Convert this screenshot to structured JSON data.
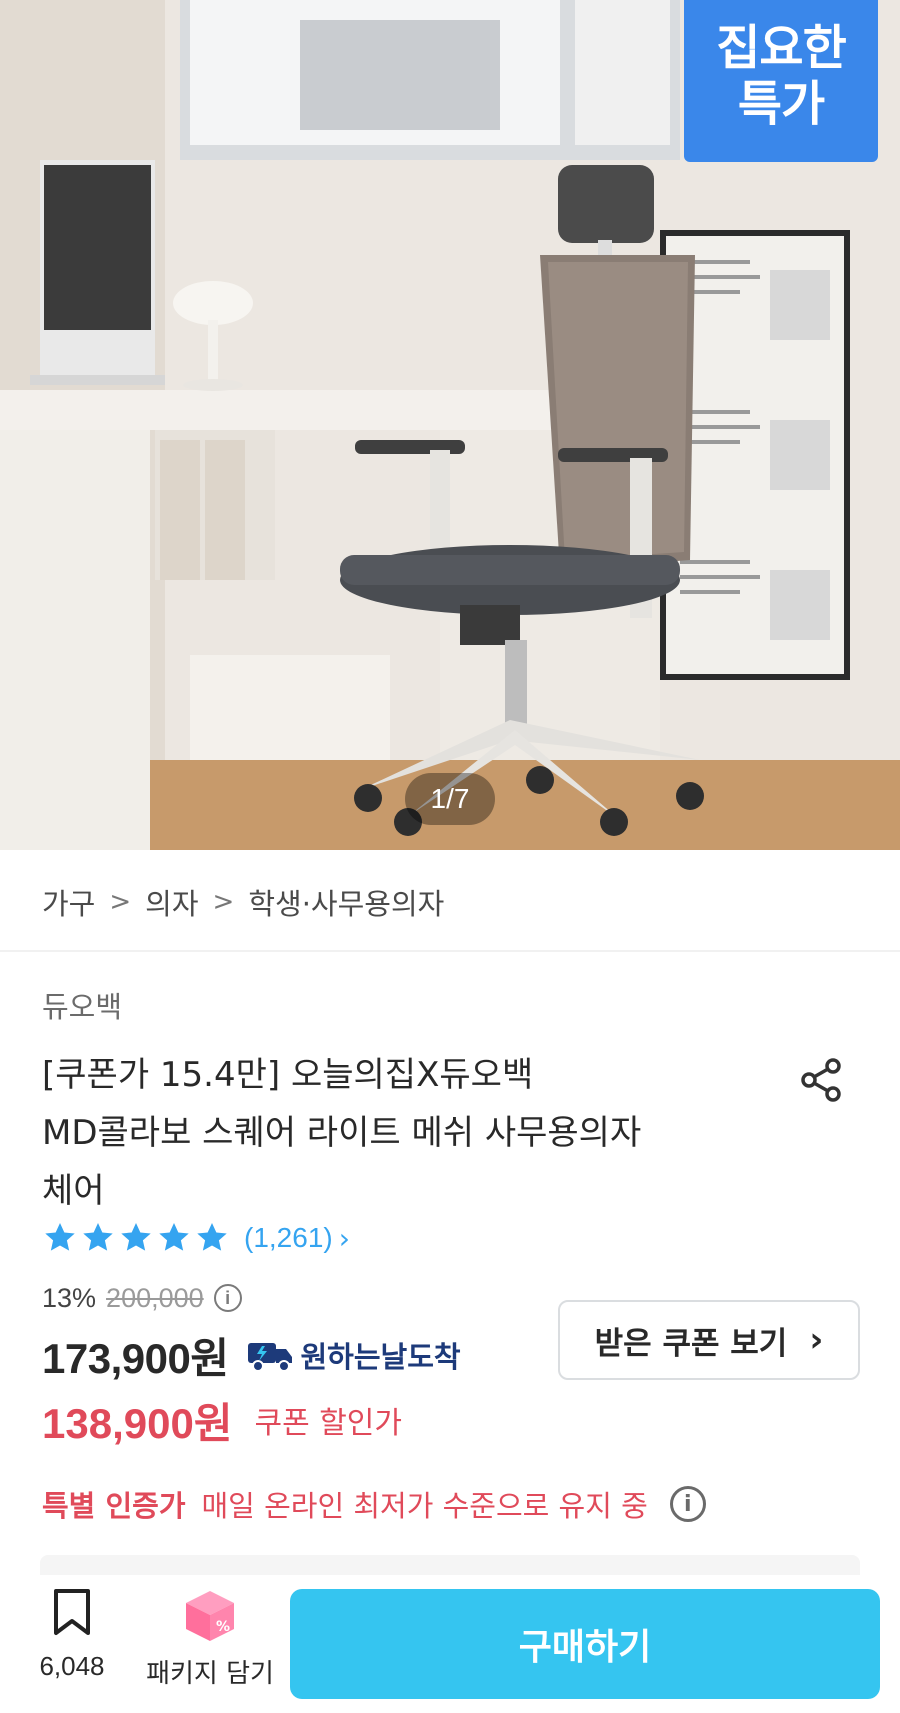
{
  "hero": {
    "promo_line1": "집요한",
    "promo_line2": "특가",
    "image_counter": "1/7"
  },
  "breadcrumb": [
    "가구",
    "의자",
    "학생·사무용의자"
  ],
  "product": {
    "brand": "듀오백",
    "title_lines": [
      "[쿠폰가 15.4만] 오늘의집X듀오백",
      "MD콜라보 스퀘어 라이트 메쉬 사무용의자",
      "체어"
    ],
    "rating_stars": 5,
    "review_count": "(1,261)",
    "discount_rate": "13%",
    "original_price": "200,000",
    "sale_price": "173,900원",
    "delivery_label": "원하는날도착",
    "coupon_button": "받은 쿠폰 보기",
    "coupon_price": "138,900원",
    "coupon_price_label": "쿠폰 할인가",
    "certified_tag": "특별 인증가",
    "certified_desc": "매일 온라인 최저가 수준으로 유지 중"
  },
  "bottom_bar": {
    "bookmark_count": "6,048",
    "package_label": "패키지 담기",
    "buy_label": "구매하기"
  },
  "colors": {
    "accent": "#35c5f0",
    "promo": "#3a87ea",
    "star": "#35a4f0",
    "coupon_red": "#e04a5a"
  }
}
